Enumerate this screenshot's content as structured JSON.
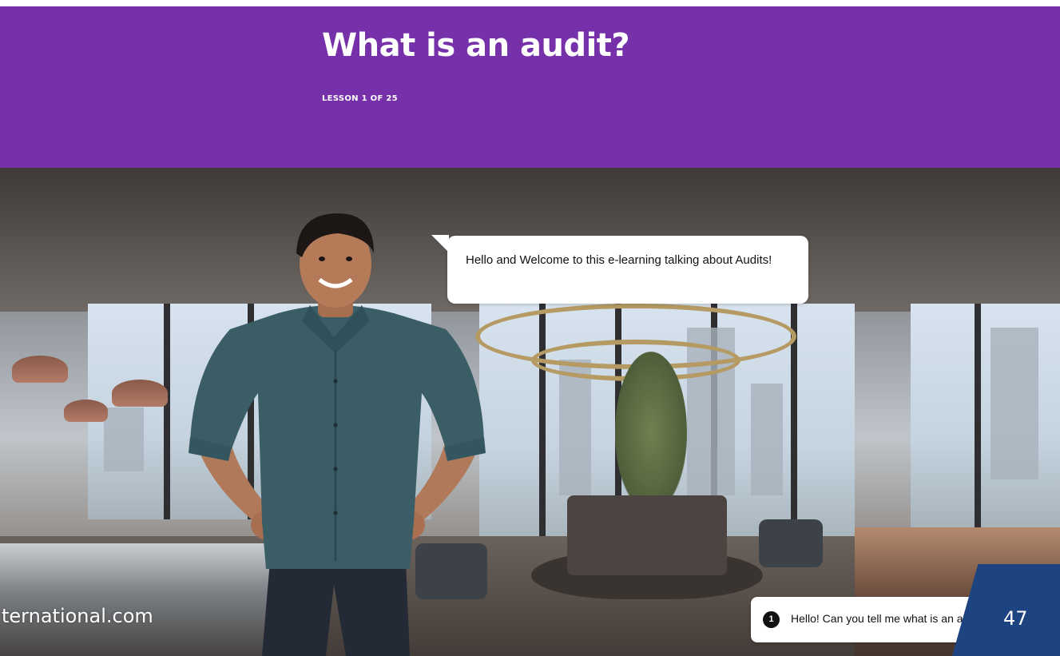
{
  "header": {
    "title": "What is an audit?",
    "lesson_label": "LESSON 1 OF 25"
  },
  "colors": {
    "header_bg": "#7631aa",
    "badge_bg": "#1d4480",
    "bubble_bg": "#ffffff"
  },
  "speech_bubble": {
    "text": "Hello and Welcome to this e-learning talking about Audits!"
  },
  "watermark": {
    "text": "ternational.com"
  },
  "response_option": {
    "number": "1",
    "text": "Hello! Can you tell me what is an audit?"
  },
  "page_badge": {
    "number": "47"
  },
  "icons": {
    "character": "presenter-avatar",
    "background": "office-lounge-scene"
  }
}
